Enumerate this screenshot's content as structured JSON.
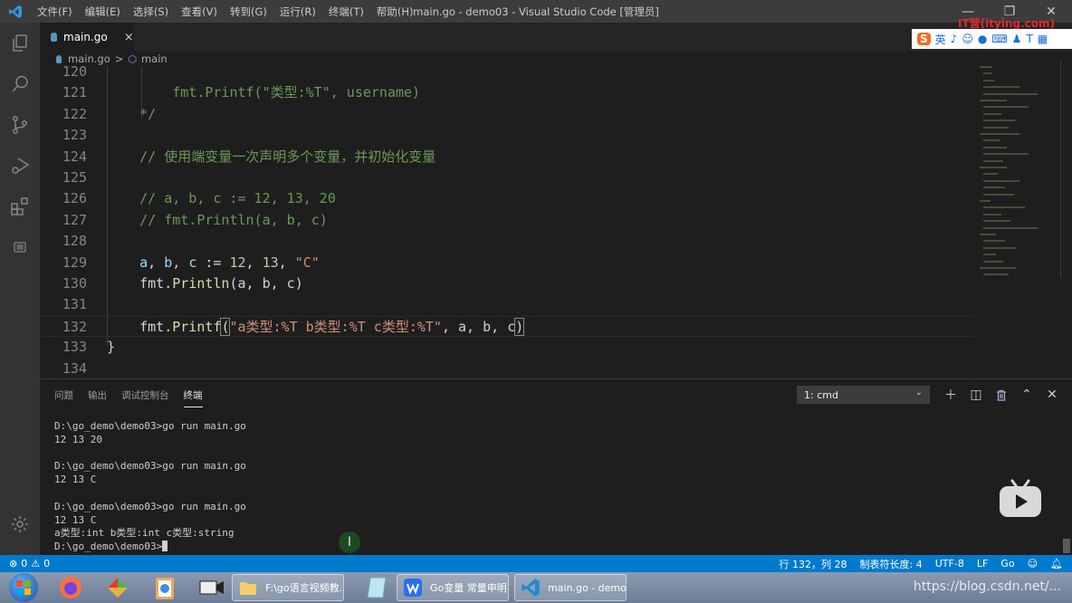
{
  "window": {
    "title": "main.go - demo03 - Visual Studio Code [管理员]",
    "menu": [
      "文件(F)",
      "编辑(E)",
      "选择(S)",
      "查看(V)",
      "转到(G)",
      "运行(R)",
      "终端(T)",
      "帮助(H)"
    ],
    "controls": {
      "minimize": "—",
      "restore": "❐",
      "close": "✕"
    }
  },
  "activity_bar": {
    "items": [
      "explorer-icon",
      "search-icon",
      "source-control-icon",
      "run-debug-icon",
      "extensions-icon",
      "outline-icon"
    ],
    "bottom": "gear-icon"
  },
  "tabs": [
    {
      "label": "main.go",
      "active": true,
      "close": "×"
    }
  ],
  "breadcrumb": {
    "file": "main.go",
    "separator": ">",
    "symbol": "main"
  },
  "editor": {
    "lines": [
      {
        "n": "120",
        "tokens": []
      },
      {
        "n": "121",
        "tokens": [
          {
            "t": "        fmt.Printf(\"类型:%T\", username)",
            "c": "com"
          }
        ]
      },
      {
        "n": "122",
        "tokens": [
          {
            "t": "    */",
            "c": "com"
          }
        ]
      },
      {
        "n": "123",
        "tokens": []
      },
      {
        "n": "124",
        "tokens": [
          {
            "t": "    // 使用端变量一次声明多个变量，并初始化变量",
            "c": "com"
          }
        ]
      },
      {
        "n": "125",
        "tokens": []
      },
      {
        "n": "126",
        "tokens": [
          {
            "t": "    // a, b, c := 12, 13, 20",
            "c": "com"
          }
        ]
      },
      {
        "n": "127",
        "tokens": [
          {
            "t": "    // fmt.Println(a, b, c)",
            "c": "com"
          }
        ]
      },
      {
        "n": "128",
        "tokens": []
      },
      {
        "n": "129",
        "tokens": [
          {
            "t": "    ",
            "c": "pl"
          },
          {
            "t": "a",
            "c": "var"
          },
          {
            "t": ", ",
            "c": "pl"
          },
          {
            "t": "b",
            "c": "var"
          },
          {
            "t": ", ",
            "c": "pl"
          },
          {
            "t": "c",
            "c": "var"
          },
          {
            "t": " := ",
            "c": "pl"
          },
          {
            "t": "12",
            "c": "num"
          },
          {
            "t": ", ",
            "c": "pl"
          },
          {
            "t": "13",
            "c": "num"
          },
          {
            "t": ", ",
            "c": "pl"
          },
          {
            "t": "\"C\"",
            "c": "str"
          }
        ]
      },
      {
        "n": "130",
        "tokens": [
          {
            "t": "    fmt.",
            "c": "pl"
          },
          {
            "t": "Println",
            "c": "fn"
          },
          {
            "t": "(a, b, c)",
            "c": "pl"
          }
        ]
      },
      {
        "n": "131",
        "tokens": []
      },
      {
        "n": "132",
        "current": true,
        "tokens": [
          {
            "t": "    fmt.",
            "c": "pl"
          },
          {
            "t": "Printf",
            "c": "fn"
          },
          {
            "t": "(",
            "c": "pl",
            "b": true
          },
          {
            "t": "\"a类型:%T b类型:%T c类型:%T\"",
            "c": "str"
          },
          {
            "t": ", a, b, c",
            "c": "pl"
          },
          {
            "t": ")",
            "c": "pl",
            "b": true
          }
        ]
      },
      {
        "n": "133",
        "tokens": [
          {
            "t": "}",
            "c": "pl"
          }
        ]
      },
      {
        "n": "134",
        "tokens": []
      }
    ]
  },
  "panel": {
    "tabs": [
      "问题",
      "输出",
      "调试控制台",
      "终端"
    ],
    "active_tab": "终端",
    "terminal_select": "1: cmd",
    "actions": [
      "plus-icon",
      "split-icon",
      "trash-icon",
      "chevron-up-icon",
      "close-icon"
    ],
    "terminal_lines": [
      "D:\\go_demo\\demo03>go run main.go",
      "12 13 20",
      "",
      "D:\\go_demo\\demo03>go run main.go",
      "12 13 C",
      "",
      "D:\\go_demo\\demo03>go run main.go",
      "12 13 C",
      "a类型:int b类型:int c类型:string",
      "D:\\go_demo\\demo03>"
    ]
  },
  "status_bar": {
    "errors": "0",
    "warnings": "0",
    "position": "行 132，列 28",
    "tab_size": "制表符长度: 4",
    "encoding": "UTF-8",
    "eol": "LF",
    "language": "Go"
  },
  "taskbar": {
    "buttons": [
      {
        "label": "F:\\go语言视频教...",
        "icon": "folder-icon"
      },
      {
        "label": "Go变量 常量申明...",
        "icon": "wps-icon"
      },
      {
        "label": "main.go - demo...",
        "icon": "vscode-icon"
      }
    ],
    "watermark": "https://blog.csdn.net/..."
  },
  "overlay": {
    "ime_site": "IT营(itying.com)",
    "ime_text": "英"
  },
  "colors": {
    "accent": "#007acc",
    "comment": "#6a9955",
    "string": "#ce9178",
    "number": "#b5cea8",
    "variable": "#9cdcfe",
    "function": "#dcdcaa"
  }
}
